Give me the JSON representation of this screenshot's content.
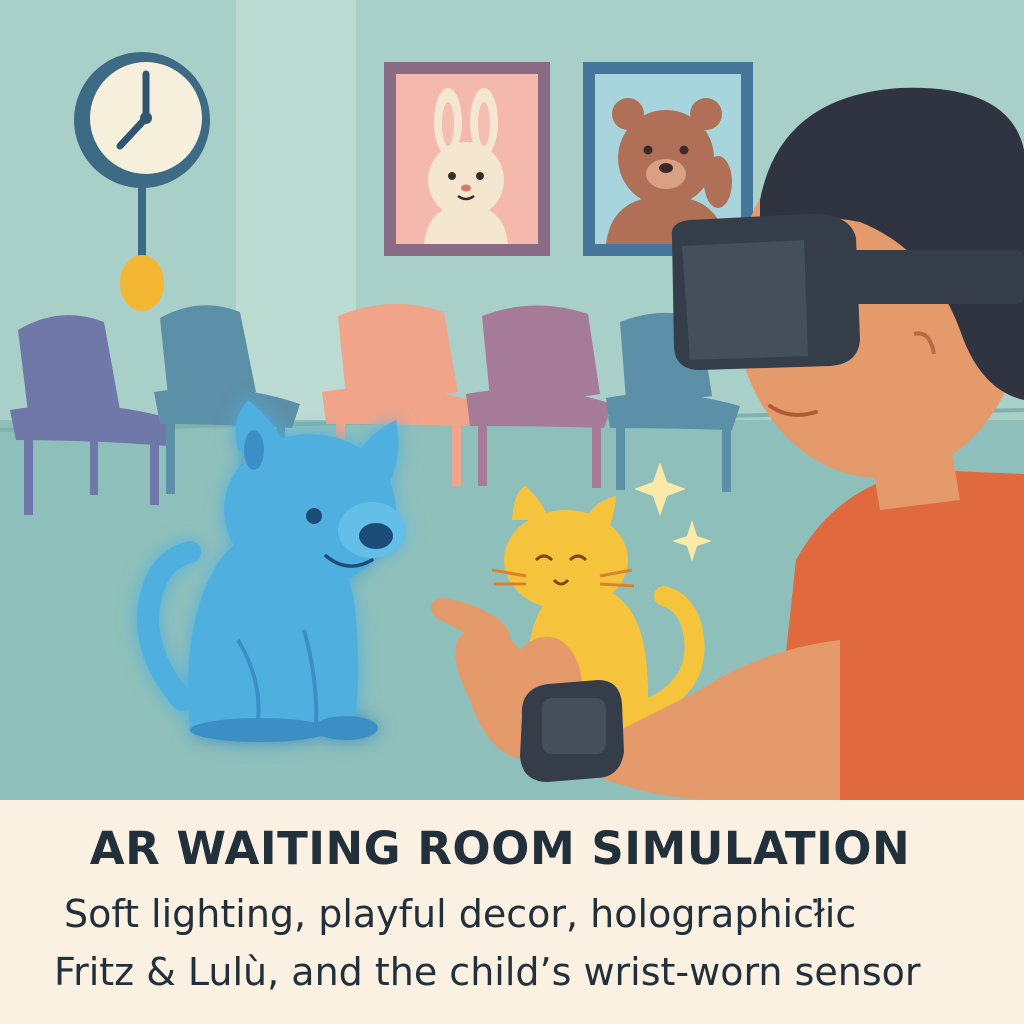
{
  "caption": {
    "title": "AR WAITING ROOM SIMULATION",
    "line1": "Soft lighting, playful decor, holographicł̇ic",
    "line2": "Fritz & Lulù, and the child’s wrist-worn sensor"
  },
  "colors": {
    "wall": "#a9cfc9",
    "floor": "#8fbfba",
    "caption_bg": "#fbf1e2",
    "text": "#21303a",
    "hologram_dog": "#4fb0e0",
    "cat": "#f6c43c",
    "shirt": "#e06a3e"
  },
  "icons": [
    "wall-clock-icon",
    "sparkle-icon",
    "vr-headset-icon",
    "wrist-sensor-icon"
  ]
}
